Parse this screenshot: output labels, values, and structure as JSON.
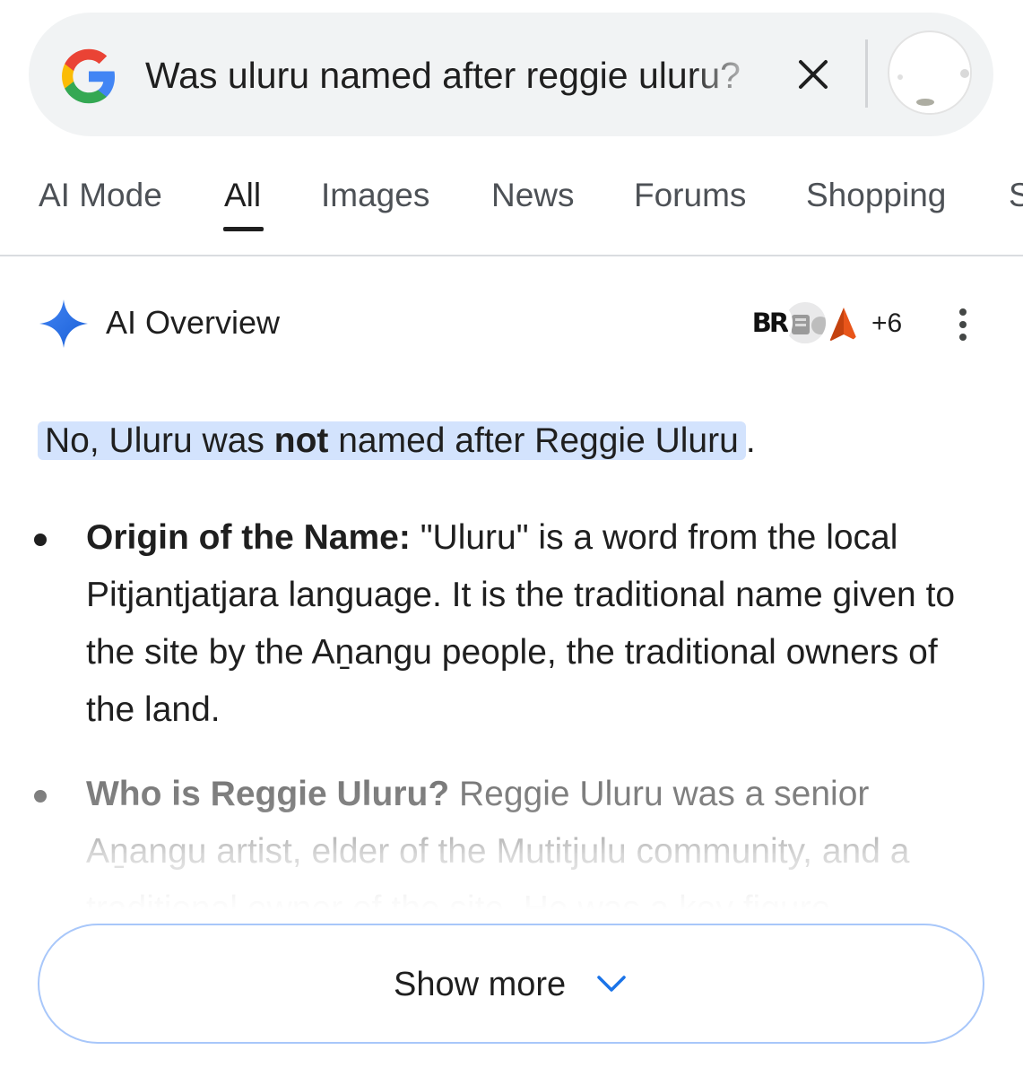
{
  "search": {
    "query": "Was uluru named after reggie uluru?"
  },
  "tabs": [
    {
      "label": "AI Mode"
    },
    {
      "label": "All",
      "active": true
    },
    {
      "label": "Images"
    },
    {
      "label": "News"
    },
    {
      "label": "Forums"
    },
    {
      "label": "Shopping"
    },
    {
      "label": "S"
    }
  ],
  "ai_overview": {
    "title": "AI Overview",
    "sources_count": "+6",
    "source_logo_text": "BR"
  },
  "answer": {
    "prefix": "No, Uluru was ",
    "emphasis": "not",
    "suffix": " named after Reggie Uluru",
    "end_punct": "."
  },
  "bullets": [
    {
      "heading": "Origin of the Name:",
      "text": " \"Uluru\" is a word from the local Pitjantjatjara language. It is the traditional name given to the site by the Aṉangu people, the traditional owners of the land."
    },
    {
      "heading": "Who is Reggie Uluru?",
      "text": " Reggie Uluru was a senior Aṉangu artist, elder of the Mutitjulu community, and a traditional owner of the site. He was a key figure"
    }
  ],
  "show_more": {
    "label": "Show more"
  },
  "colors": {
    "highlight": "#d3e3fd",
    "show_more_border": "#a8c7fa",
    "accent_blue": "#1a73e8"
  }
}
